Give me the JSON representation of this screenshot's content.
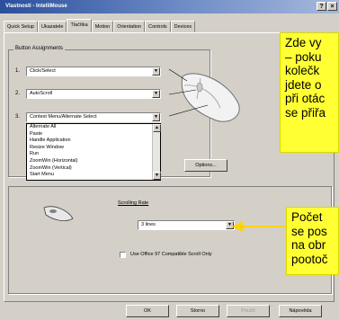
{
  "window": {
    "title": "Vlastnosti - IntelliMouse",
    "help_btn": "?",
    "close_btn": "×"
  },
  "tabs": [
    {
      "label": "Quick Setup"
    },
    {
      "label": "Ukazatele"
    },
    {
      "label": "Tlačítka"
    },
    {
      "label": "Motion"
    },
    {
      "label": "Orientation"
    },
    {
      "label": "Controls"
    },
    {
      "label": "Devices"
    }
  ],
  "buttons_group": {
    "label": "Button Assignments",
    "rows": [
      {
        "num": "1.",
        "value": "Click/Select"
      },
      {
        "num": "2.",
        "value": "AutoScroll"
      },
      {
        "num": "3.",
        "value": "Context Menu/Alternate Select"
      }
    ],
    "dropdown_options": [
      "Alternate All",
      "Paste",
      "Handle Application",
      "Resize Window",
      "Run",
      "ZoomWin (Horizontal)",
      "ZoomWin (Vertical)",
      "Start Menu"
    ],
    "options_button": "Options..."
  },
  "wheel_group": {
    "label": "Scrolling Rate",
    "value": "3 lines",
    "checkbox_label": "Use Office 97 Compatible Scroll Only"
  },
  "footer": {
    "ok": "OK",
    "cancel": "Storno",
    "apply": "Použít",
    "help": "Nápověda"
  },
  "callouts": {
    "top": [
      "Zde vy",
      "– poku",
      "kolečk",
      "jdete o",
      "při otác",
      "se přiřa"
    ],
    "bottom": [
      "Počet",
      "se pos",
      "na obr",
      "pootoč"
    ]
  },
  "colors": {
    "callout": "#ffff33",
    "arrow": "#ffd400",
    "selection": "#000080",
    "titlebar": "#2a4f9c"
  }
}
